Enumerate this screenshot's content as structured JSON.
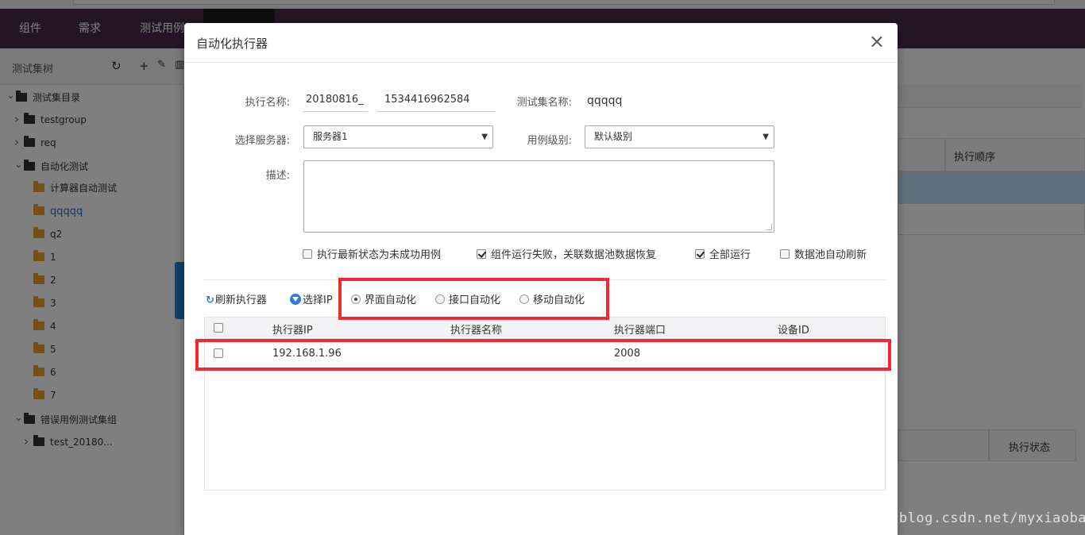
{
  "app": {
    "nav": [
      "组件",
      "需求",
      "测试用例"
    ]
  },
  "sidebar": {
    "title": "测试集树",
    "icons": [
      "refresh-icon",
      "plus-icon",
      "edit-icon",
      "delete-icon"
    ],
    "tree": [
      {
        "label": "测试集目录",
        "folder": "dark",
        "arrow": "v"
      },
      {
        "label": "testgroup",
        "folder": "dark",
        "arrow": ">"
      },
      {
        "label": "req",
        "folder": "dark",
        "arrow": ">"
      },
      {
        "label": "自动化测试",
        "folder": "dark",
        "arrow": "v"
      },
      {
        "label": "计算器自动测试",
        "folder": "orange",
        "arrow": ""
      },
      {
        "label": "qqqqq",
        "folder": "orange",
        "arrow": "",
        "active": true
      },
      {
        "label": "q2",
        "folder": "orange",
        "arrow": ""
      },
      {
        "label": "1",
        "folder": "orange",
        "arrow": ""
      },
      {
        "label": "2",
        "folder": "orange",
        "arrow": ""
      },
      {
        "label": "3",
        "folder": "orange",
        "arrow": ""
      },
      {
        "label": "4",
        "folder": "orange",
        "arrow": ""
      },
      {
        "label": "5",
        "folder": "orange",
        "arrow": ""
      },
      {
        "label": "6",
        "folder": "orange",
        "arrow": ""
      },
      {
        "label": "7",
        "folder": "orange",
        "arrow": ""
      },
      {
        "label": "错误用例测试集组",
        "folder": "dark",
        "arrow": "v"
      },
      {
        "label": "test_20180...",
        "folder": "dark",
        "arrow": ">"
      }
    ]
  },
  "background": {
    "col_exec_order": "执行顺序",
    "col_exec_status": "执行状态"
  },
  "modal": {
    "title": "自动化执行器",
    "close": "×",
    "form": {
      "exec_name_label": "执行名称:",
      "exec_name_prefix": "20180816_",
      "exec_name_value": "1534416962584",
      "suite_name_label": "测试集名称:",
      "suite_name_value": "qqqqq",
      "server_label": "选择服务器:",
      "server_value": "服务器1",
      "case_level_label": "用例级别:",
      "case_level_value": "默认级别",
      "desc_label": "描述:",
      "desc_value": ""
    },
    "options": [
      {
        "label": "执行最新状态为未成功用例",
        "checked": false
      },
      {
        "label": "组件运行失败，关联数据池数据恢复",
        "checked": true
      },
      {
        "label": "全部运行",
        "checked": true
      },
      {
        "label": "数据池自动刷新",
        "checked": false
      }
    ],
    "toolbar": {
      "refresh": "刷新执行器",
      "select_ip": "选择IP"
    },
    "modes": [
      {
        "label": "界面自动化",
        "selected": true
      },
      {
        "label": "接口自动化",
        "selected": false
      },
      {
        "label": "移动自动化",
        "selected": false
      }
    ],
    "table": {
      "columns": [
        "执行器IP",
        "执行器名称",
        "执行器端口",
        "设备ID"
      ],
      "rows": [
        {
          "ip": "192.168.1.96",
          "name": "",
          "port": "2008",
          "device_id": ""
        }
      ]
    }
  },
  "watermark": "https://blog.csdn.net/myxiaobai",
  "colors": {
    "nav_bg": "#4a2b48",
    "highlight_red": "#ee2b33",
    "accent_blue": "#2b7fd6",
    "folder_orange": "#e9a031"
  }
}
